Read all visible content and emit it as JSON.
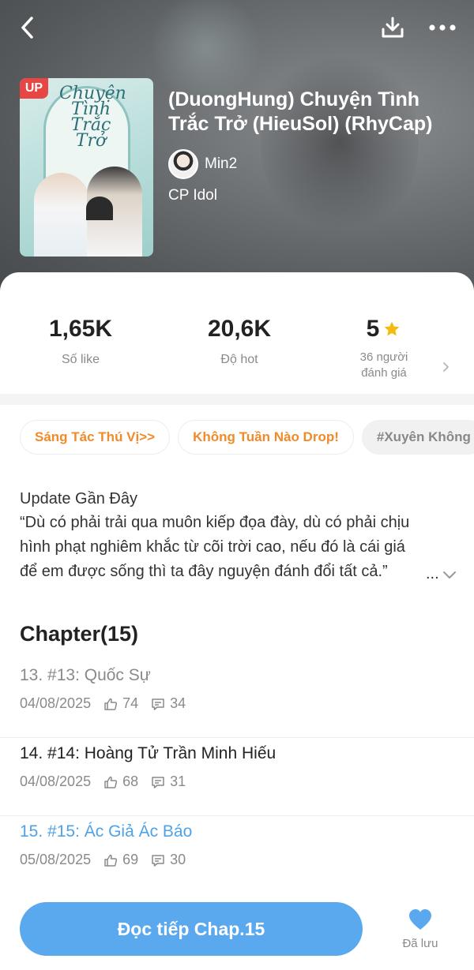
{
  "header": {
    "badge": "UP",
    "cover_title_art": "Chuyện Tình Trắc Trở",
    "title": "(DuongHung) Chuyện Tình Trắc Trở (HieuSol) (RhyCap)",
    "author": "Min2",
    "category": "CP Idol",
    "icons": [
      "back-icon",
      "download-icon",
      "more-icon"
    ]
  },
  "stats": {
    "likes_value": "1,65K",
    "likes_label": "Số like",
    "hot_value": "20,6K",
    "hot_label": "Độ hot",
    "rating_value": "5",
    "rating_label_line1": "36 người",
    "rating_label_line2": "đánh giá"
  },
  "tags": [
    "Sáng Tác Thú Vị>>",
    "Không Tuần Nào Drop!",
    "#Xuyên Không"
  ],
  "update": {
    "title": "Update Gần Đây",
    "text": "“Dù có phải trải qua muôn kiếp đọa đày, dù có phải chịu hình phạt nghiêm khắc từ cõi trời cao, nếu đó là cái giá để em được sống thì ta đây nguyện đánh đổi tất cả.”",
    "ellipsis": "..."
  },
  "chapters_heading": "Chapter(15)",
  "chapters": [
    {
      "title": "13. #13: Quốc Sự",
      "date": "04/08/2025",
      "likes": "74",
      "comments": "34",
      "state": "read"
    },
    {
      "title": "14. #14: Hoàng Tử Trần Minh Hiếu",
      "date": "04/08/2025",
      "likes": "68",
      "comments": "31",
      "state": "normal"
    },
    {
      "title": "15. #15: Ác Giả Ác Báo",
      "date": "05/08/2025",
      "likes": "69",
      "comments": "30",
      "state": "current"
    }
  ],
  "bottom": {
    "read_button": "Đọc tiếp Chap.15",
    "saved_label": "Đã lưu"
  },
  "colors": {
    "accent_blue": "#5aa9ef",
    "current_chapter": "#4ea2e8",
    "tag_orange": "#f08a2a",
    "badge_red": "#e84545",
    "star_gold": "#f6b90e"
  }
}
